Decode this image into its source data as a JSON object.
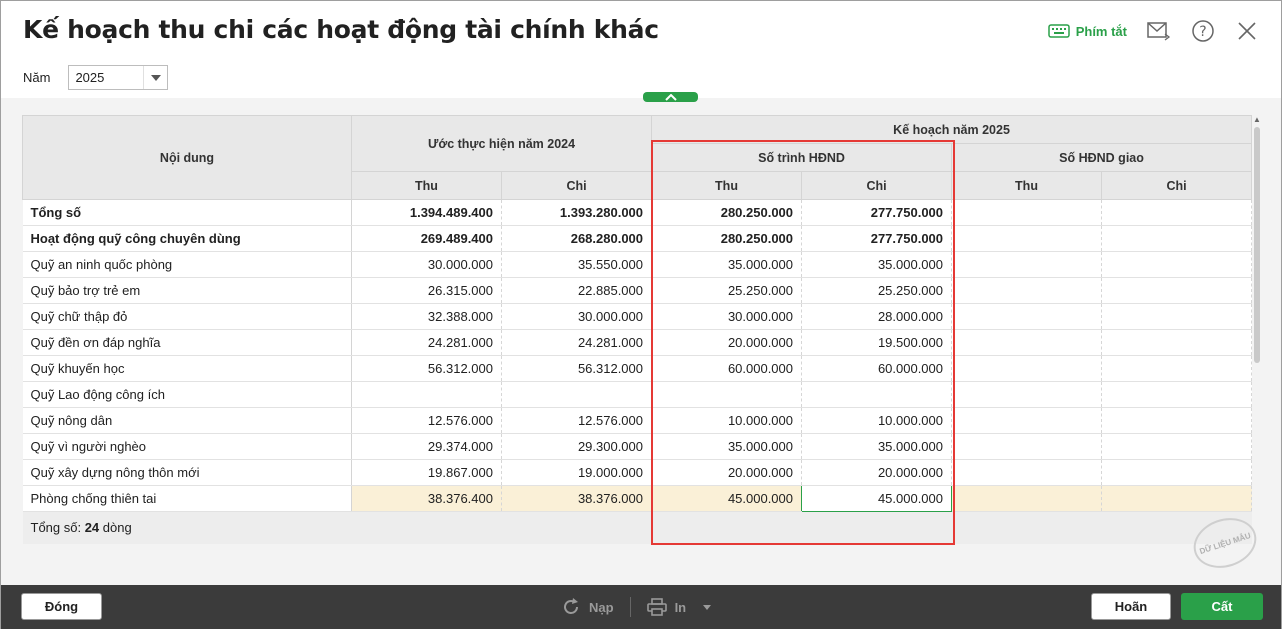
{
  "window": {
    "title": "Kế hoạch thu chi các hoạt động tài chính khác",
    "shortcut_label": "Phím tắt",
    "icons": [
      "keyboard-icon",
      "mail-icon",
      "help-icon",
      "close-icon"
    ]
  },
  "filter": {
    "year_label": "Năm",
    "year_value": "2025"
  },
  "table": {
    "header": {
      "content": "Nội dung",
      "estimate_group": "Ước thực hiện năm 2024",
      "plan_group": "Kế hoạch năm 2025",
      "submitted_group": "Số trình HĐND",
      "assigned_group": "Số HĐND giao",
      "thu": "Thu",
      "chi": "Chi"
    },
    "rows": [
      {
        "name": "Tổng số",
        "u_thu": "1.394.489.400",
        "u_chi": "1.393.280.000",
        "s_thu": "280.250.000",
        "s_chi": "277.750.000",
        "g_thu": "",
        "g_chi": ""
      },
      {
        "name": "Hoạt động quỹ công chuyên dùng",
        "u_thu": "269.489.400",
        "u_chi": "268.280.000",
        "s_thu": "280.250.000",
        "s_chi": "277.750.000",
        "g_thu": "",
        "g_chi": ""
      },
      {
        "name": "Quỹ an ninh quốc phòng",
        "u_thu": "30.000.000",
        "u_chi": "35.550.000",
        "s_thu": "35.000.000",
        "s_chi": "35.000.000",
        "g_thu": "",
        "g_chi": ""
      },
      {
        "name": "Quỹ bảo trợ trẻ em",
        "u_thu": "26.315.000",
        "u_chi": "22.885.000",
        "s_thu": "25.250.000",
        "s_chi": "25.250.000",
        "g_thu": "",
        "g_chi": ""
      },
      {
        "name": "Quỹ chữ thập đỏ",
        "u_thu": "32.388.000",
        "u_chi": "30.000.000",
        "s_thu": "30.000.000",
        "s_chi": "28.000.000",
        "g_thu": "",
        "g_chi": ""
      },
      {
        "name": "Quỹ đền ơn đáp nghĩa",
        "u_thu": "24.281.000",
        "u_chi": "24.281.000",
        "s_thu": "20.000.000",
        "s_chi": "19.500.000",
        "g_thu": "",
        "g_chi": ""
      },
      {
        "name": "Quỹ khuyến học",
        "u_thu": "56.312.000",
        "u_chi": "56.312.000",
        "s_thu": "60.000.000",
        "s_chi": "60.000.000",
        "g_thu": "",
        "g_chi": ""
      },
      {
        "name": "Quỹ Lao động công ích",
        "u_thu": "",
        "u_chi": "",
        "s_thu": "",
        "s_chi": "",
        "g_thu": "",
        "g_chi": ""
      },
      {
        "name": "Quỹ nông dân",
        "u_thu": "12.576.000",
        "u_chi": "12.576.000",
        "s_thu": "10.000.000",
        "s_chi": "10.000.000",
        "g_thu": "",
        "g_chi": ""
      },
      {
        "name": "Quỹ vì người nghèo",
        "u_thu": "29.374.000",
        "u_chi": "29.300.000",
        "s_thu": "35.000.000",
        "s_chi": "35.000.000",
        "g_thu": "",
        "g_chi": ""
      },
      {
        "name": "Quỹ xây dựng nông thôn mới",
        "u_thu": "19.867.000",
        "u_chi": "19.000.000",
        "s_thu": "20.000.000",
        "s_chi": "20.000.000",
        "g_thu": "",
        "g_chi": ""
      },
      {
        "name": "Phòng chống thiên tai",
        "u_thu": "38.376.400",
        "u_chi": "38.376.000",
        "s_thu": "45.000.000",
        "s_chi": "45.000.000",
        "g_thu": "",
        "g_chi": ""
      }
    ],
    "footer_prefix": "Tổng số: ",
    "footer_count": "24",
    "footer_suffix": " dòng"
  },
  "stamp_text": "DỮ LIỆU MẪU",
  "bottom": {
    "close": "Đóng",
    "reload": "Nạp",
    "print": "In",
    "undo": "Hoãn",
    "save": "Cất"
  },
  "colors": {
    "accent": "#2aa049",
    "highlight": "#e53935",
    "selected_row": "#faf0d7"
  }
}
